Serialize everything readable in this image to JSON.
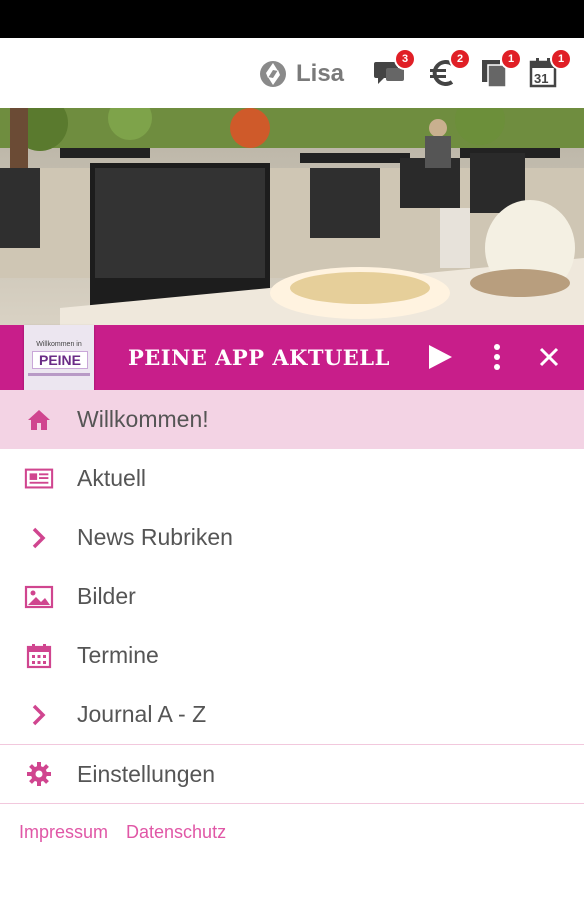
{
  "topbar": {
    "user_name": "Lisa",
    "badges": {
      "messages": "3",
      "euro": "2",
      "documents": "1",
      "calendar": "1"
    },
    "calendar_day": "31"
  },
  "appbar": {
    "title": "PEINE APP AKTUELL",
    "logo_text_top": "Willkommen in",
    "logo_text_main": "PEINE"
  },
  "menu": {
    "items": [
      {
        "label": "Willkommen!",
        "icon": "home-icon"
      },
      {
        "label": "Aktuell",
        "icon": "newspaper-icon"
      },
      {
        "label": "News Rubriken",
        "icon": "chevron-right-icon"
      },
      {
        "label": "Bilder",
        "icon": "image-icon"
      },
      {
        "label": "Termine",
        "icon": "calendar-icon"
      },
      {
        "label": "Journal A - Z",
        "icon": "chevron-right-icon"
      }
    ],
    "settings_label": "Einstellungen"
  },
  "footer": {
    "impressum": "Impressum",
    "datenschutz": "Datenschutz"
  },
  "colors": {
    "accent": "#c81e8a",
    "active_bg": "#f3d3e4",
    "icon_pink": "#d0458f",
    "badge": "#e01f26"
  }
}
